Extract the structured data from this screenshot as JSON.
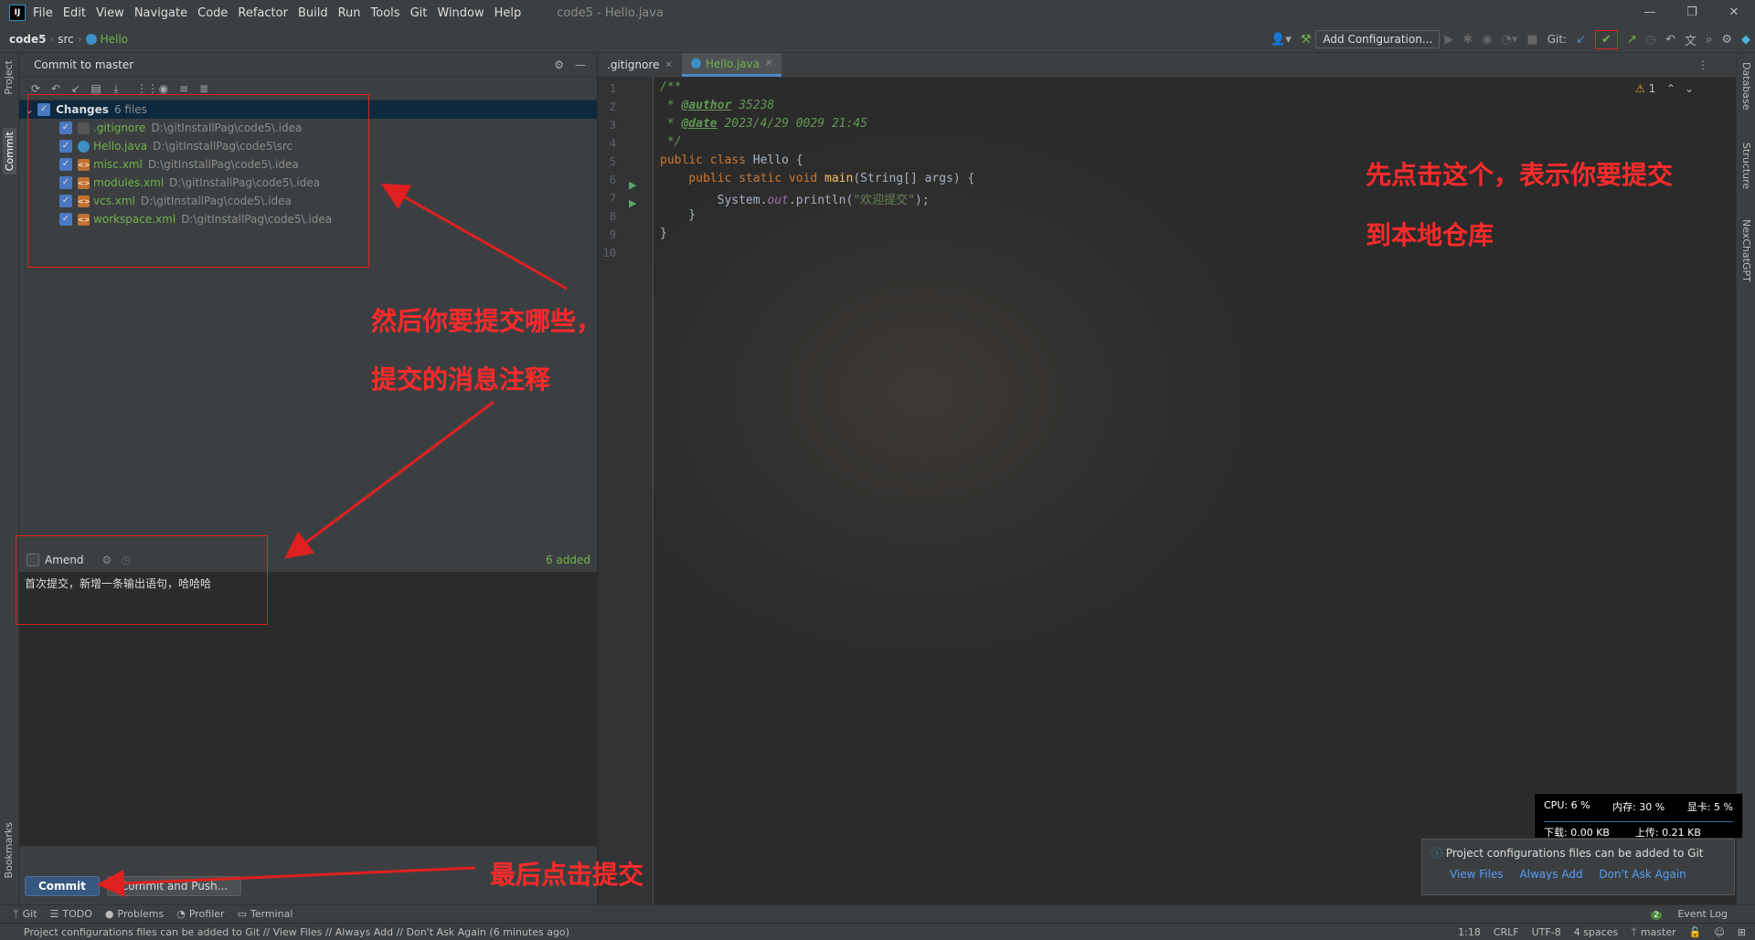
{
  "menubar": {
    "items": [
      "File",
      "Edit",
      "View",
      "Navigate",
      "Code",
      "Refactor",
      "Build",
      "Run",
      "Tools",
      "Git",
      "Window",
      "Help"
    ],
    "title": "code5 - Hello.java"
  },
  "navbar": {
    "crumbs": [
      "code5",
      "src",
      "Hello"
    ],
    "add_config": "Add Configuration...",
    "git_label": "Git:"
  },
  "left_stripe": {
    "project": "Project",
    "commit": "Commit",
    "bookmarks": "Bookmarks"
  },
  "right_stripe": {
    "database": "Database",
    "structure": "Structure",
    "chatgpt": "NexChatGPT"
  },
  "commit_panel": {
    "title": "Commit to master",
    "changes_label": "Changes",
    "changes_count": "6 files",
    "files": [
      {
        "name": ".gitignore",
        "path": "D:\\gitInstallPag\\code5\\.idea"
      },
      {
        "name": "Hello.java",
        "path": "D:\\gitInstallPag\\code5\\src"
      },
      {
        "name": "misc.xml",
        "path": "D:\\gitInstallPag\\code5\\.idea"
      },
      {
        "name": "modules.xml",
        "path": "D:\\gitInstallPag\\code5\\.idea"
      },
      {
        "name": "vcs.xml",
        "path": "D:\\gitInstallPag\\code5\\.idea"
      },
      {
        "name": "workspace.xml",
        "path": "D:\\gitInstallPag\\code5\\.idea"
      }
    ],
    "amend": "Amend",
    "added": "6 added",
    "message": "首次提交，新增一条输出语句，哈哈哈",
    "commit_btn": "Commit",
    "commit_push_btn": "Commit and Push..."
  },
  "editor": {
    "tabs": [
      ".gitignore",
      "Hello.java"
    ],
    "warnings": "1",
    "lines": [
      "1",
      "2",
      "3",
      "4",
      "5",
      "6",
      "7",
      "8",
      "9",
      "10"
    ],
    "code": {
      "l1": "/**",
      "l2a": " * ",
      "l2b": "@author",
      "l2c": " 35238",
      "l3a": " * ",
      "l3b": "@date",
      "l3c": " 2023/4/29 0029 21:45",
      "l4": " */",
      "l5a": "public class ",
      "l5b": "Hello {",
      "l6a": "    public static void ",
      "l6b": "main",
      "l6c": "(String[] args) {",
      "l7a": "        System.",
      "l7b": "out",
      "l7c": ".println(",
      "l7d": "\"欢迎提交\"",
      "l7e": ");",
      "l8": "    }",
      "l9": "}"
    }
  },
  "annotations": {
    "a1_line1": "先点击这个，表示你要提交",
    "a1_line2": "到本地仓库",
    "a2_line1": "然后你要提交哪些，",
    "a2_line2": "提交的消息注释",
    "a3": "最后点击提交"
  },
  "perf": {
    "cpu": "CPU: 6 %",
    "mem": "内存: 30 %",
    "gpu": "显卡: 5 %",
    "down": "下载: 0.00 KB",
    "up": "上传: 0.21 KB"
  },
  "notification": {
    "text": "Project configurations files can be added to Git",
    "links": [
      "View Files",
      "Always Add",
      "Don't Ask Again"
    ]
  },
  "bottom_tools": [
    "Git",
    "TODO",
    "Problems",
    "Profiler",
    "Terminal"
  ],
  "event_log": "Event Log",
  "event_count": "2",
  "status": {
    "message": "Project configurations files can be added to Git // View Files // Always Add // Don't Ask Again (6 minutes ago)",
    "pos": "1:18",
    "crlf": "CRLF",
    "enc": "UTF-8",
    "indent": "4 spaces",
    "branch": "master"
  },
  "colors": {
    "accent": "#4a88c7",
    "annotation": "#ff2a2a",
    "added": "#6fb34a"
  }
}
